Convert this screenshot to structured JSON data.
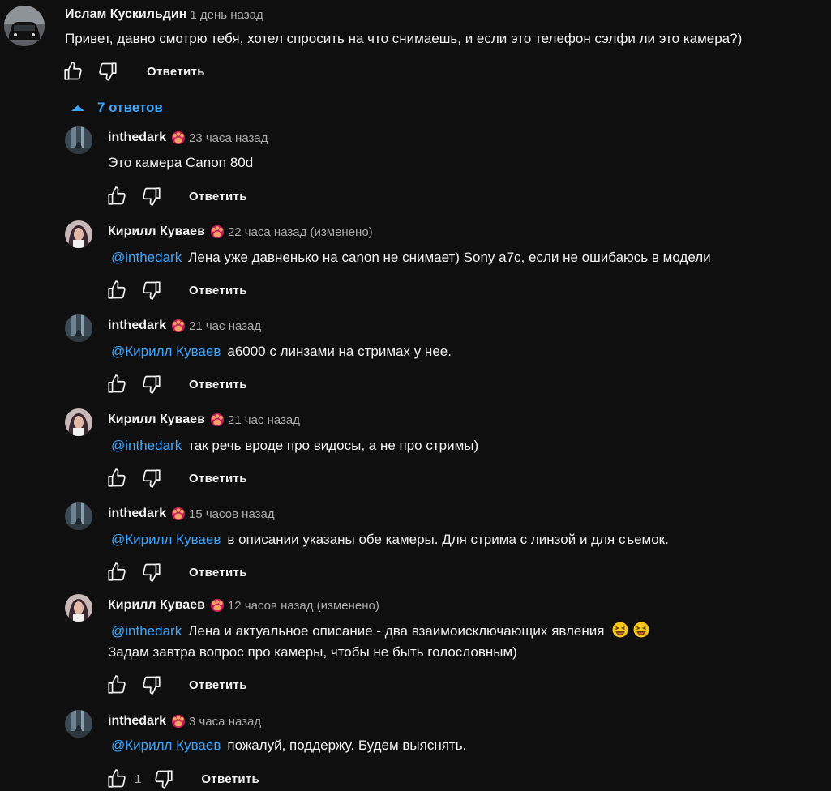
{
  "top_comment": {
    "author": "Ислам Кускильдин",
    "time": "1 день назад",
    "text": "Привет, давно смотрю тебя, хотел спросить на что снимаешь, и если это телефон сэлфи ли это камера?)",
    "reply_label": "Ответить"
  },
  "replies_toggle": {
    "label": "7 ответов"
  },
  "replies": [
    {
      "author": "inthedark",
      "time": "23 часа назад",
      "mention": "",
      "text": "Это камера Canon 80d",
      "reply_label": "Ответить",
      "likes": ""
    },
    {
      "author": "Кирилл Куваев",
      "time": "22 часа назад (изменено)",
      "mention": "@inthedark",
      "text": "Лена уже давненько на canon не снимает) Sony a7c, если не ошибаюсь в модели",
      "reply_label": "Ответить",
      "likes": ""
    },
    {
      "author": "inthedark",
      "time": "21 час назад",
      "mention": "@Кирилл Куваев",
      "text": "a6000 с линзами на стримах у нее.",
      "reply_label": "Ответить",
      "likes": ""
    },
    {
      "author": "Кирилл Куваев",
      "time": "21 час назад",
      "mention": "@inthedark",
      "text": "так речь вроде про видосы, а не про стримы)",
      "reply_label": "Ответить",
      "likes": ""
    },
    {
      "author": "inthedark",
      "time": "15 часов назад",
      "mention": "@Кирилл Куваев",
      "text": "в описании указаны обе камеры. Для стрима с линзой и для съемок.",
      "reply_label": "Ответить",
      "likes": ""
    },
    {
      "author": "Кирилл Куваев",
      "time": "12 часов назад (изменено)",
      "mention": "@inthedark",
      "text": "Лена и актуальное описание - два взаимоисключающих явления",
      "text2": "Задам завтра вопрос про камеры, чтобы не быть голословным)",
      "reply_label": "Ответить",
      "likes": ""
    },
    {
      "author": "inthedark",
      "time": "3 часа назад",
      "mention": "@Кирилл Куваев",
      "text": "пожалуй, поддержу. Будем выяснять.",
      "reply_label": "Ответить",
      "likes": "1"
    }
  ],
  "colors": {
    "background": "#0f0f0f",
    "link": "#3ea6ff",
    "secondary": "#aaaaaa"
  },
  "icons": {
    "like": "thumb-up-icon",
    "dislike": "thumb-down-icon",
    "badge": "member-badge-icon",
    "toggle": "chevron-up-icon",
    "emoji": "laughing-emoji-icon"
  }
}
